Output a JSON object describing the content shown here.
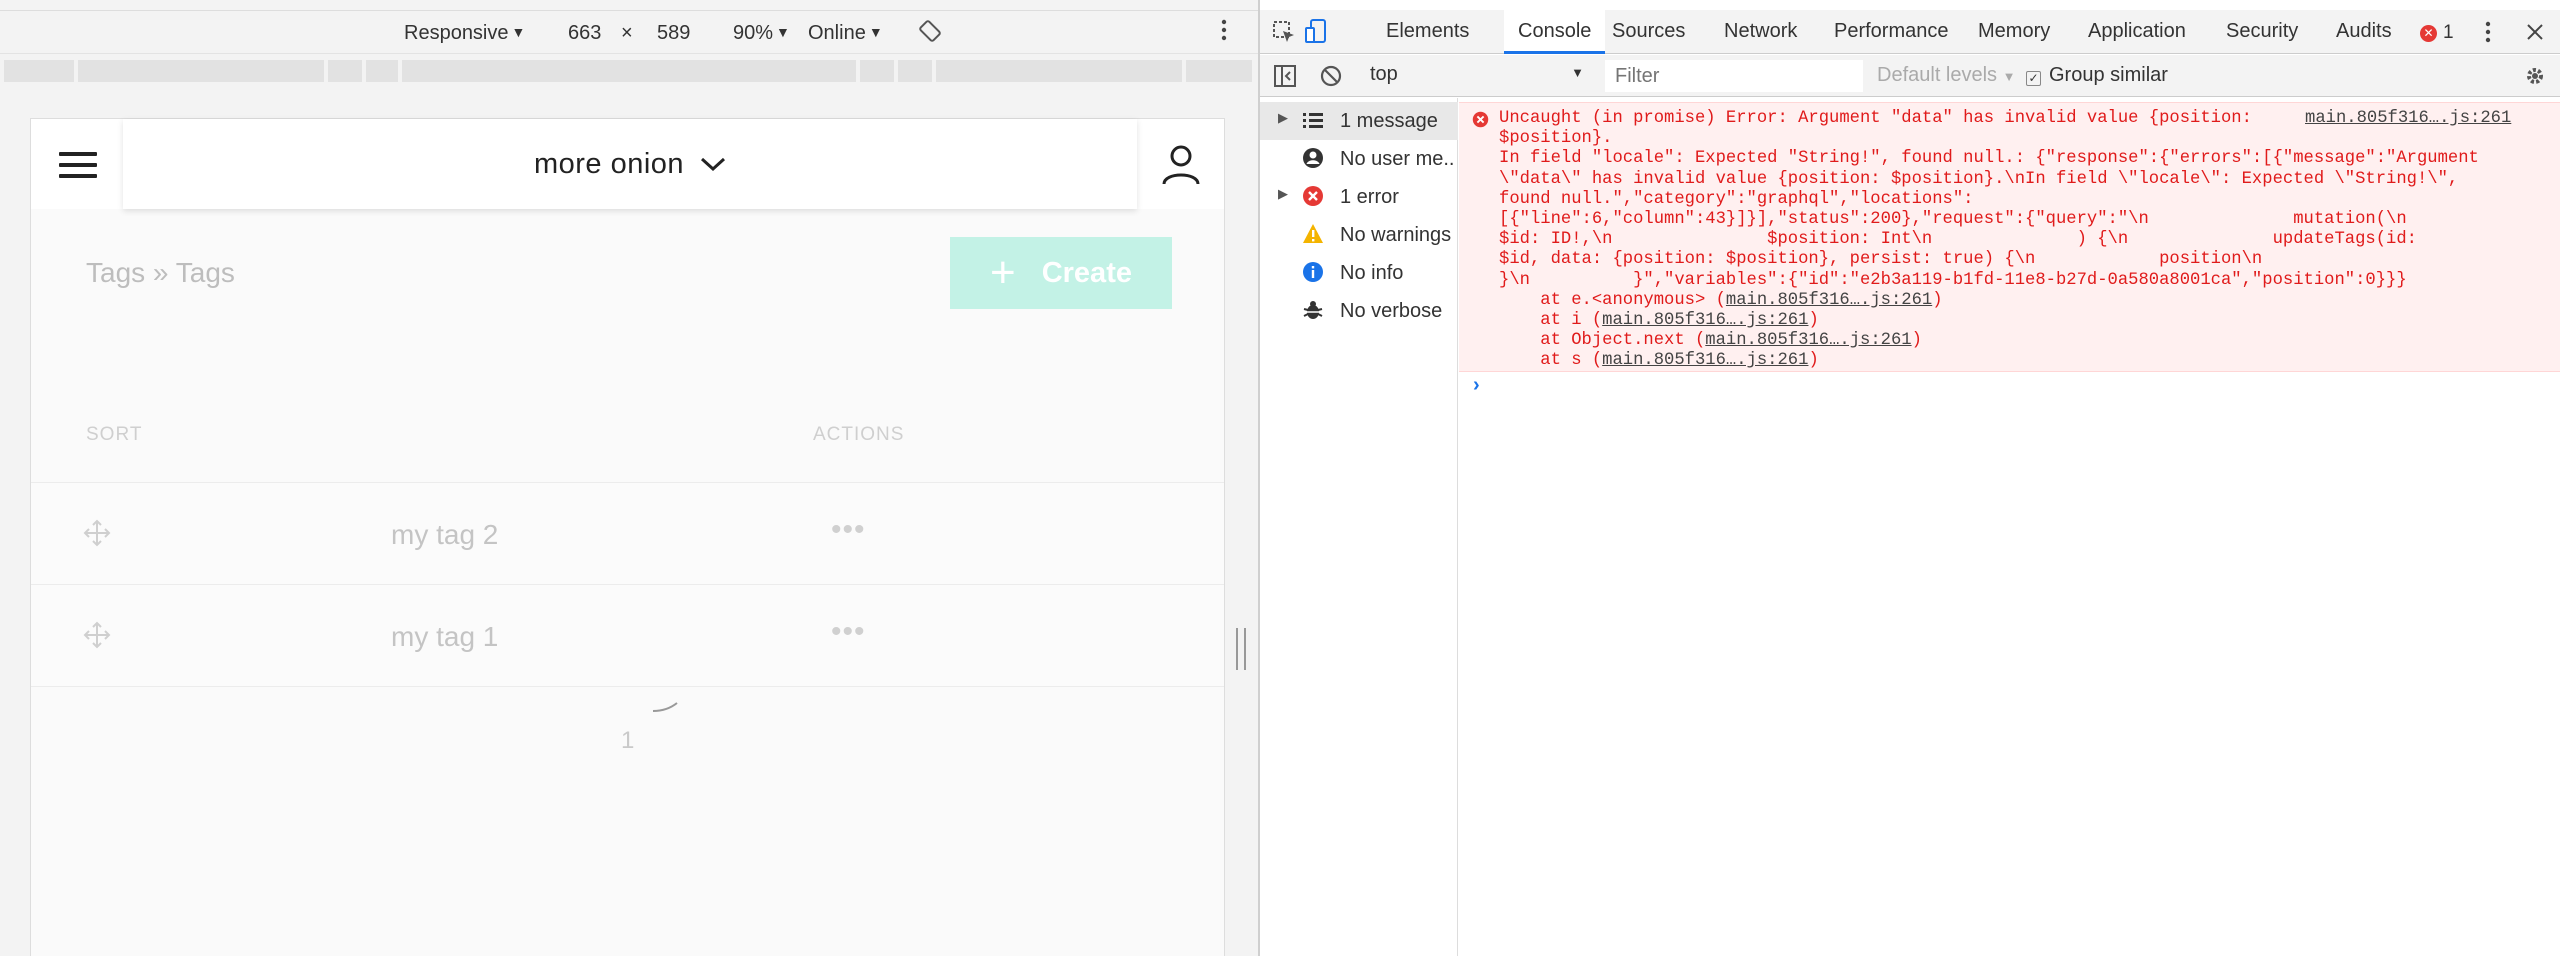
{
  "device_toolbar": {
    "device": "Responsive",
    "width": "663",
    "times": "×",
    "height": "589",
    "zoom": "90%",
    "network": "Online"
  },
  "app": {
    "header_title": "more onion",
    "breadcrumb": "Tags » Tags",
    "create_label": "Create",
    "columns": {
      "sort": "SORT",
      "actions": "ACTIONS"
    },
    "rows": [
      {
        "name": "my tag 2"
      },
      {
        "name": "my tag 1"
      }
    ],
    "more_label": "•••",
    "page_number": "1"
  },
  "devtools": {
    "tabs": [
      "Elements",
      "Console",
      "Sources",
      "Network",
      "Performance",
      "Memory",
      "Application",
      "Security",
      "Audits"
    ],
    "active_tab": "Console",
    "error_count": "1",
    "context": "top",
    "filter_placeholder": "Filter",
    "levels_label": "Default levels",
    "group_similar": "Group similar",
    "sidebar": [
      {
        "label": "1 message"
      },
      {
        "label": "No user me..."
      },
      {
        "label": "1 error"
      },
      {
        "label": "No warnings"
      },
      {
        "label": "No info"
      },
      {
        "label": "No verbose"
      }
    ],
    "error_message": "Uncaught (in promise) Error: Argument \"data\" has invalid value {position:\n$position}.\nIn field \"locale\": Expected \"String!\", found null.: {\"response\":{\"errors\":[{\"message\":\"Argument\n\\\"data\\\" has invalid value {position: $position}.\\nIn field \\\"locale\\\": Expected \\\"String!\\\",\nfound null.\",\"category\":\"graphql\",\"locations\":\n[{\"line\":6,\"column\":43}]}],\"status\":200},\"request\":{\"query\":\"\\n              mutation(\\n\n$id: ID!,\\n               $position: Int\\n              ) {\\n              updateTags(id:\n$id, data: {position: $position}, persist: true) {\\n            position\\n\n}\\n          }\",\"variables\":{\"id\":\"e2b3a119-b1fd-11e8-b27d-0a580a8001ca\",\"position\":0}}}",
    "source_link": "main.805f316….js:261",
    "stack": [
      {
        "prefix": "at e.<anonymous> (",
        "link": "main.805f316….js:261",
        "suffix": ")"
      },
      {
        "prefix": "at i (",
        "link": "main.805f316….js:261",
        "suffix": ")"
      },
      {
        "prefix": "at Object.next (",
        "link": "main.805f316….js:261",
        "suffix": ")"
      },
      {
        "prefix": "at s (",
        "link": "main.805f316….js:261",
        "suffix": ")"
      }
    ],
    "prompt": "›"
  },
  "colors": {
    "error_red": "#e01b1b",
    "error_bg": "#fff0f0",
    "create_bg": "#c3f2e6",
    "accent_blue": "#1a73e8"
  },
  "icons": [
    "hamburger-icon",
    "chevron-down-icon",
    "user-icon",
    "move-icon",
    "inspect-icon",
    "device-icon",
    "close-icon",
    "kebab-icon",
    "rotate-icon",
    "clear-console-icon",
    "sidebar-toggle-icon",
    "gear-icon",
    "error-icon",
    "warning-icon",
    "info-icon",
    "verbose-icon",
    "list-icon",
    "user-messages-icon"
  ]
}
